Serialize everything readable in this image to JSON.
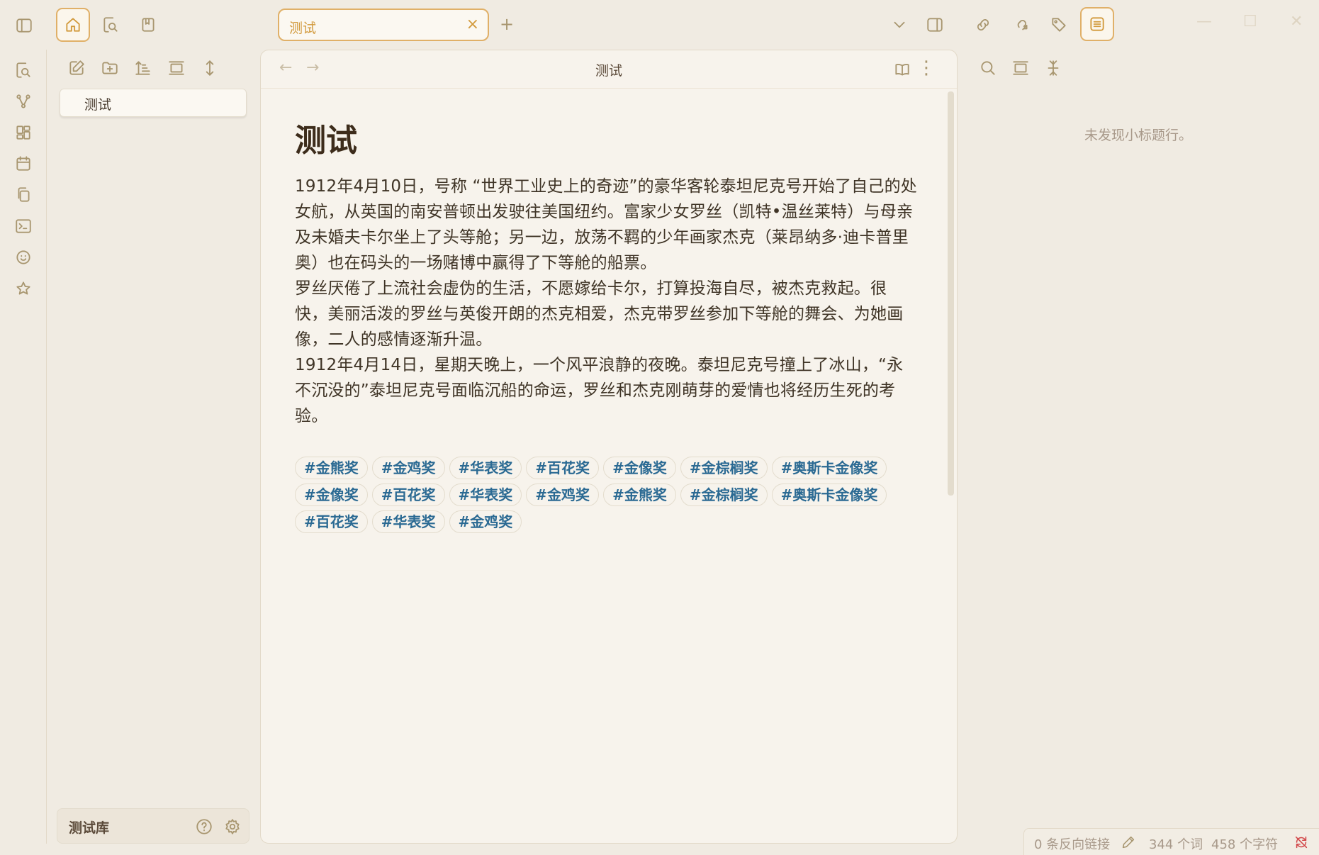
{
  "tab": {
    "title": "测试",
    "close": "×",
    "new": "+"
  },
  "explorer": {
    "files": [
      {
        "name": "测试"
      }
    ],
    "vault_name": "测试库"
  },
  "editor": {
    "header_title": "测试",
    "back": "←",
    "forward": "→",
    "more": "⋮",
    "heading": "测试",
    "paragraphs": [
      "1912年4月10日，号称 “世界工业史上的奇迹”的豪华客轮泰坦尼克号开始了自己的处女航，从英国的南安普顿出发驶往美国纽约。富家少女罗丝（凯特•温丝莱特）与母亲及未婚夫卡尔坐上了头等舱；另一边，放荡不羁的少年画家杰克（莱昂纳多·迪卡普里奥）也在码头的一场赌博中赢得了下等舱的船票。",
      "罗丝厌倦了上流社会虚伪的生活，不愿嫁给卡尔，打算投海自尽，被杰克救起。很快，美丽活泼的罗丝与英俊开朗的杰克相爱，杰克带罗丝参加下等舱的舞会、为她画像，二人的感情逐渐升温。",
      "1912年4月14日，星期天晚上，一个风平浪静的夜晚。泰坦尼克号撞上了冰山，“永不沉没的”泰坦尼克号面临沉船的命运，罗丝和杰克刚萌芽的爱情也将经历生死的考验。"
    ],
    "tags": [
      "#金熊奖",
      "#金鸡奖",
      "#华表奖",
      "#百花奖",
      "#金像奖",
      "#金棕榈奖",
      "#奥斯卡金像奖",
      "#金像奖",
      "#百花奖",
      "#华表奖",
      "#金鸡奖",
      "#金熊奖",
      "#金棕榈奖",
      "#奥斯卡金像奖",
      "#百花奖",
      "#华表奖",
      "#金鸡奖"
    ]
  },
  "outline": {
    "empty_text": "未发现小标题行。"
  },
  "status_bar": {
    "backlinks": "0 条反向链接",
    "words": "344 个词",
    "chars": "458 个字符"
  },
  "colors": {
    "accent": "#d29a3c",
    "tag": "#2b6a93",
    "background": "#f0ebe2",
    "editor_bg": "#f7f3ec"
  }
}
